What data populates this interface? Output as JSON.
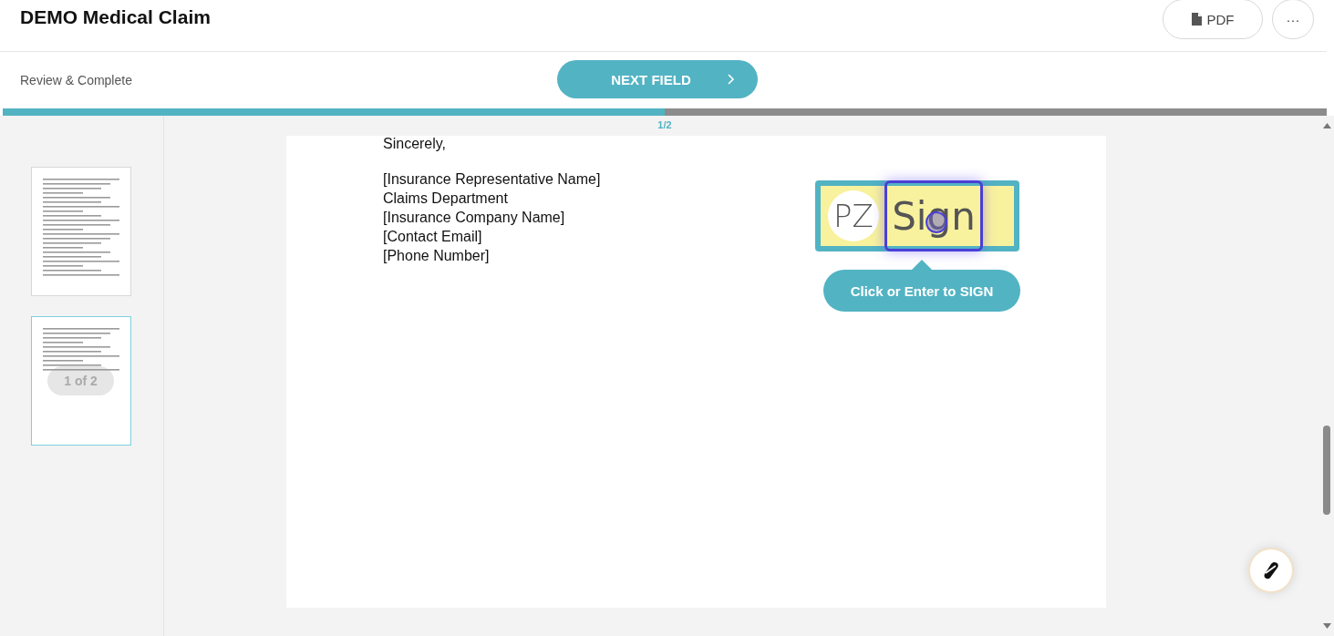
{
  "header": {
    "title": "DEMO Medical Claim",
    "buttons": [
      {
        "kind": "pdf",
        "label": "PDF"
      },
      {
        "kind": "more",
        "label": "···"
      }
    ]
  },
  "toolbar": {
    "step": "Review & Complete",
    "next_button": "NEXT FIELD"
  },
  "progress": {
    "level": 0.5,
    "label": "1/2"
  },
  "thumbnails": [
    {
      "selected": false
    },
    {
      "selected": true,
      "overlay": "1 of 2"
    }
  ],
  "document": {
    "closing": "Sincerely,",
    "lines": [
      "[Insurance Representative Name]",
      "Claims Department",
      "[Insurance Company Name]",
      "[Contact Email]",
      "[Phone Number]"
    ],
    "signature": {
      "initials": "PZ",
      "label": "Sign",
      "tooltip": "Click or Enter to SIGN"
    }
  }
}
